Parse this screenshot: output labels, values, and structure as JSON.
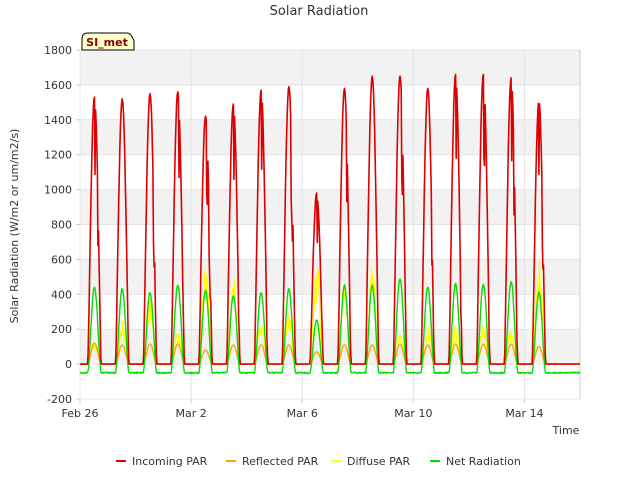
{
  "chart_data": {
    "type": "line",
    "title": "Solar Radiation",
    "xlabel": "Time",
    "ylabel": "Solar Radiation (W/m2 or um/m2/s)",
    "site_label": "SI_met",
    "x_range": [
      "2023-02-26",
      "2023-03-16"
    ],
    "ylim": [
      -200,
      1800
    ],
    "y_ticks": [
      -200,
      0,
      200,
      400,
      600,
      800,
      1000,
      1200,
      1400,
      1600,
      1800
    ],
    "x_ticks": [
      {
        "date": "2023-02-26",
        "label": "Feb 26"
      },
      {
        "date": "2023-03-02",
        "label": "Mar 2"
      },
      {
        "date": "2023-03-06",
        "label": "Mar 6"
      },
      {
        "date": "2023-03-10",
        "label": "Mar 10"
      },
      {
        "date": "2023-03-14",
        "label": "Mar 14"
      }
    ],
    "grid": true,
    "legend_position": "bottom",
    "colors": {
      "incoming": "#dd0000",
      "reflected": "#ffa500",
      "diffuse": "#ffff00",
      "net": "#00dd00",
      "band": "#f2f2f2",
      "axis": "#cccccc",
      "text": "#333333"
    },
    "day_dates": [
      "2023-02-26",
      "2023-02-27",
      "2023-02-28",
      "2023-03-01",
      "2023-03-02",
      "2023-03-03",
      "2023-03-04",
      "2023-03-05",
      "2023-03-06",
      "2023-03-07",
      "2023-03-08",
      "2023-03-09",
      "2023-03-10",
      "2023-03-11",
      "2023-03-12",
      "2023-03-13",
      "2023-03-14",
      "2023-03-15"
    ],
    "series": [
      {
        "name": "Incoming PAR",
        "key": "incoming",
        "daily_peak": [
          1530,
          1520,
          1550,
          1560,
          1420,
          1490,
          1570,
          1590,
          980,
          1580,
          1650,
          1650,
          1580,
          1660,
          1660,
          1640,
          1510,
          0
        ]
      },
      {
        "name": "Reflected PAR",
        "key": "reflected",
        "daily_peak": [
          120,
          110,
          115,
          115,
          80,
          110,
          110,
          110,
          70,
          110,
          110,
          115,
          110,
          115,
          115,
          115,
          100,
          0
        ]
      },
      {
        "name": "Diffuse PAR",
        "key": "diffuse",
        "daily_peak": [
          150,
          300,
          420,
          200,
          640,
          560,
          250,
          300,
          620,
          490,
          620,
          200,
          230,
          230,
          250,
          230,
          640,
          0
        ]
      },
      {
        "name": "Net Radiation",
        "key": "net",
        "daily_peak": [
          440,
          430,
          410,
          455,
          420,
          390,
          410,
          430,
          250,
          450,
          450,
          490,
          440,
          460,
          460,
          470,
          410,
          0
        ],
        "night_value": -50
      }
    ]
  }
}
